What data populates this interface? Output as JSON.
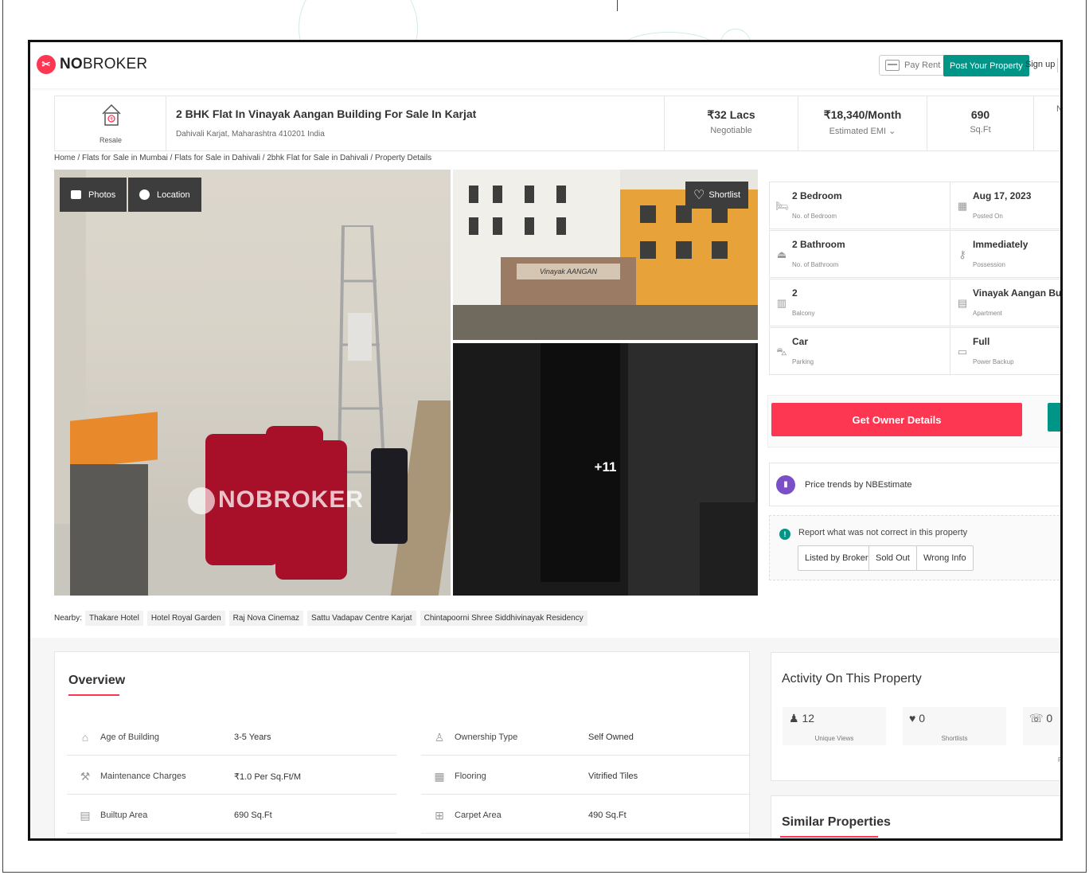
{
  "header": {
    "logo_text_bold": "NO",
    "logo_text": "BROKER",
    "pay_rent": "Pay Rent",
    "post_property": "Post Your Property",
    "sign_up": "Sign up"
  },
  "listing": {
    "badge": "Resale",
    "title": "2 BHK Flat In Vinayak Aangan Building For Sale In Karjat",
    "address": "Dahivali Karjat, Maharashtra 410201 India",
    "price": "₹32 Lacs",
    "price_sub": "Negotiable",
    "emi": "₹18,340/Month",
    "emi_sub": "Estimated EMI ⌄",
    "area": "690",
    "area_sub": "Sq.Ft",
    "more": "N"
  },
  "breadcrumb": "Home / Flats for Sale in Mumbai / Flats for Sale in Dahivali / 2bhk Flat for Sale in Dahivali / Property Details",
  "gallery": {
    "photos_btn": "Photos",
    "location_btn": "Location",
    "shortlist_btn": "Shortlist",
    "more_count": "+11",
    "watermark": "NOBROKER",
    "building_sign": "Vinayak AANGAN"
  },
  "details": [
    {
      "value": "2 Bedroom",
      "label": "No. of Bedroom",
      "icon": "bed-icon"
    },
    {
      "value": "Aug 17, 2023",
      "label": "Posted On",
      "icon": "calendar-icon"
    },
    {
      "value": "2 Bathroom",
      "label": "No. of Bathroom",
      "icon": "bathroom-icon"
    },
    {
      "value": "Immediately",
      "label": "Possession",
      "icon": "key-icon"
    },
    {
      "value": "2",
      "label": "Balcony",
      "icon": "balcony-icon"
    },
    {
      "value": "Vinayak Aangan Bu...",
      "label": "Apartment",
      "icon": "building-icon"
    },
    {
      "value": "Car",
      "label": "Parking",
      "icon": "car-icon"
    },
    {
      "value": "Full",
      "label": "Power Backup",
      "icon": "battery-icon"
    }
  ],
  "owner_button": "Get Owner Details",
  "price_trends": "Price trends by NBEstimate",
  "report": {
    "text": "Report what was not correct in this property",
    "options": [
      "Listed by Broker",
      "Sold Out",
      "Wrong Info"
    ]
  },
  "nearby": {
    "label": "Nearby:",
    "places": [
      "Thakare Hotel",
      "Hotel Royal Garden",
      "Raj Nova Cinemaz",
      "Sattu Vadapav Centre Karjat",
      "Chintapoorni Shree Siddhivinayak Residency"
    ]
  },
  "overview": {
    "title": "Overview",
    "rows": [
      {
        "label": "Age of Building",
        "value": "3-5 Years",
        "icon": "building-age-icon"
      },
      {
        "label": "Ownership Type",
        "value": "Self Owned",
        "icon": "owner-icon"
      },
      {
        "label": "Maintenance Charges",
        "value": "₹1.0 Per Sq.Ft/M",
        "icon": "maintenance-icon"
      },
      {
        "label": "Flooring",
        "value": "Vitrified Tiles",
        "icon": "flooring-icon"
      },
      {
        "label": "Builtup Area",
        "value": "690 Sq.Ft",
        "icon": "builtup-icon"
      },
      {
        "label": "Carpet Area",
        "value": "490 Sq.Ft",
        "icon": "carpet-icon"
      }
    ]
  },
  "activity": {
    "title": "Activity On This Property",
    "stats": [
      {
        "value": "12",
        "label": "Unique Views",
        "icon": "person-icon"
      },
      {
        "value": "0",
        "label": "Shortlists",
        "icon": "heart-icon"
      },
      {
        "value": "0",
        "label": "",
        "icon": "phone-icon"
      }
    ],
    "more": "F"
  },
  "similar_title": "Similar Properties",
  "colors": {
    "brand_red": "#fd3752",
    "brand_teal": "#009587",
    "nbestimate_purple": "#7a4fc8"
  }
}
